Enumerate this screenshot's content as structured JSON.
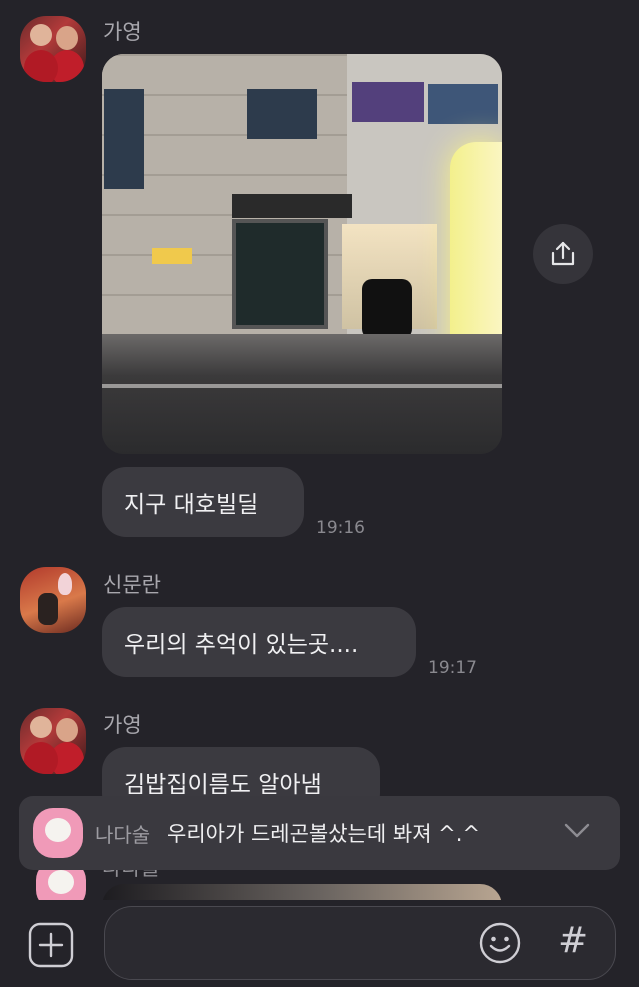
{
  "messages": [
    {
      "sender": "가영",
      "type": "photo"
    },
    {
      "sender": "가영",
      "text": "지구 대호빌딜",
      "time": "19:16"
    },
    {
      "sender": "신문란",
      "text": "우리의 추억이 있는곳....",
      "time": "19:17"
    },
    {
      "sender": "가영",
      "text": "김밥집이름도 알아냄"
    }
  ],
  "notification": {
    "sender": "나다술",
    "message": "우리아가 드레곤볼샀는데 봐져 ^.^"
  },
  "partial": {
    "sender": "나다술"
  },
  "composer": {
    "hash_label": "#"
  },
  "icons": {
    "share": "share-icon",
    "collapse": "chevron-down-icon",
    "plus": "plus-icon",
    "emoji": "smiley-icon"
  }
}
